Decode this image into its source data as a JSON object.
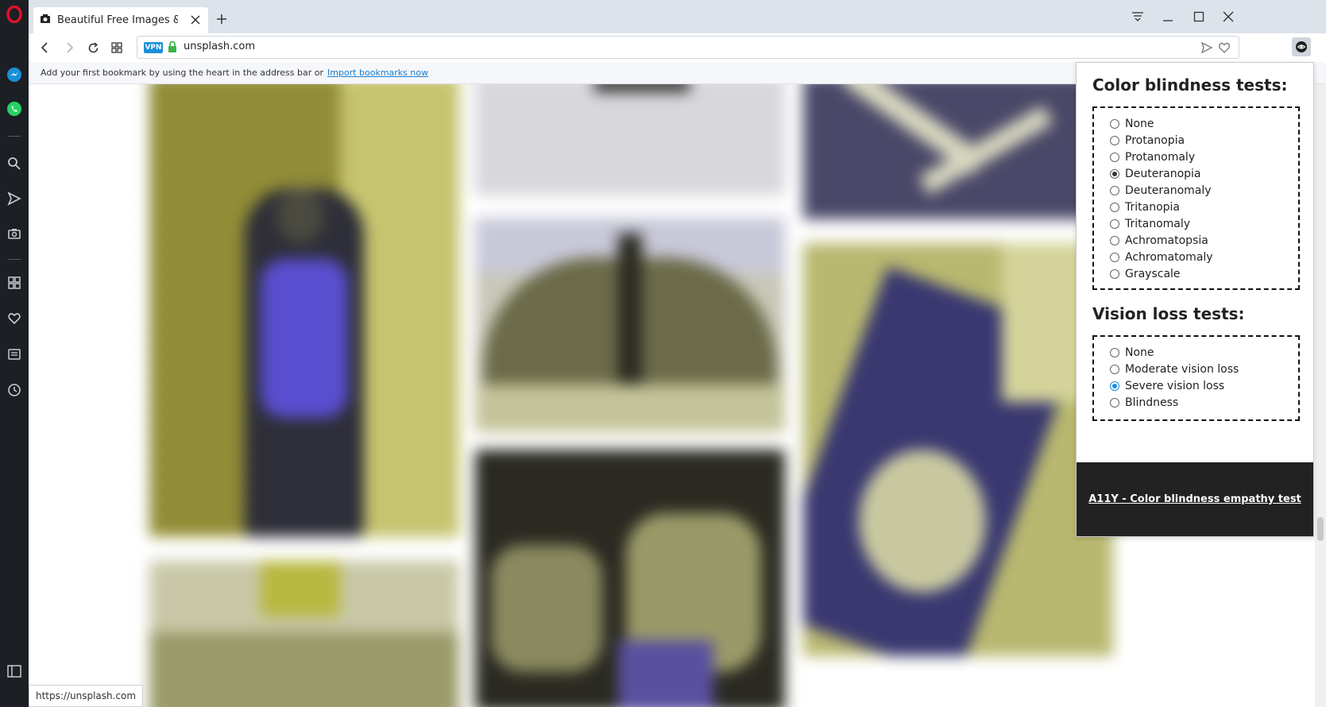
{
  "browser": {
    "tab_title": "Beautiful Free Images & Pictures",
    "url": "unsplash.com",
    "vpn_label": "VPN",
    "status_url": "https://unsplash.com"
  },
  "bookmark_bar": {
    "text": "Add your first bookmark by using the heart in the address bar or",
    "import_link": "Import bookmarks now"
  },
  "popup": {
    "color_title": "Color blindness tests:",
    "color_options": [
      "None",
      "Protanopia",
      "Protanomaly",
      "Deuteranopia",
      "Deuteranomaly",
      "Tritanopia",
      "Tritanomaly",
      "Achromatopsia",
      "Achromatomaly",
      "Grayscale"
    ],
    "color_selected": "Deuteranopia",
    "vision_title": "Vision loss tests:",
    "vision_options": [
      "None",
      "Moderate vision loss",
      "Severe vision loss",
      "Blindness"
    ],
    "vision_selected": "Severe vision loss",
    "footer_link": "A11Y - Color blindness empathy test"
  },
  "colors": {
    "sidebar_bg": "#1c1f24",
    "opera_red": "#e0102a",
    "messenger_blue": "#1a8fd8",
    "whatsapp_green": "#25d366",
    "accent_blue": "#1a8fd8",
    "popup_footer": "#222222"
  }
}
